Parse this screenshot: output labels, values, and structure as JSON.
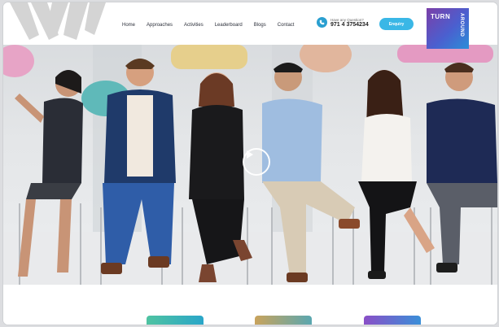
{
  "header": {
    "nav": [
      "Home",
      "Approaches",
      "Activities",
      "Leaderboard",
      "Blogs",
      "Contact"
    ],
    "phone_question": "Have any Question?",
    "phone_number": "971 4 3754234",
    "enquiry_label": "Enquiry",
    "brand_top": "TURN",
    "brand_side": "AROUND"
  },
  "hero": {
    "play_icon": "play-icon"
  },
  "colors": {
    "accent": "#3ab7e6",
    "brand_from": "#7b3fa8",
    "brand_to": "#2b8ed8",
    "card1": "#4fc3a1",
    "card2": "#c9a35c",
    "card3": "#8a4fc7"
  }
}
